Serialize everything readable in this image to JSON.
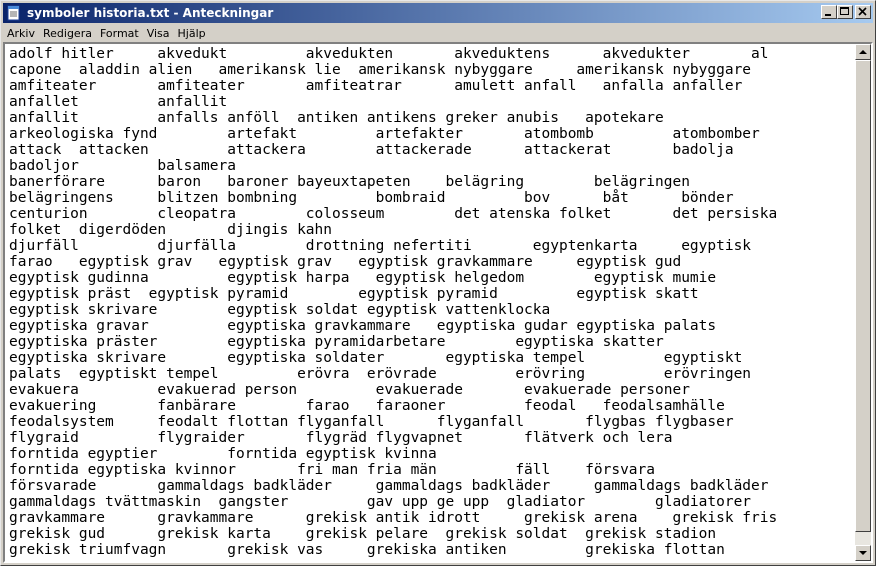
{
  "window": {
    "title": "symboler historia.txt - Anteckningar",
    "icons": {
      "app": "notepad-icon",
      "minimize": "minimize-icon",
      "maximize": "maximize-icon",
      "close": "close-icon"
    }
  },
  "menu": [
    "Arkiv",
    "Redigera",
    "Format",
    "Visa",
    "Hjälp"
  ],
  "lines": [
    "adolf hitler     akvedukt         akvedukten       akveduktens      akvedukter       al",
    "capone  aladdin alien   amerikansk lie  amerikansk nybyggare     amerikansk nybyggare",
    "amfiteater       amfiteater       amfiteatrar      amulett anfall   anfalla anfaller",
    "anfallet         anfallit",
    "anfallit         anfalls anföll  antiken antikens greker anubis   apotekare",
    "arkeologiska fynd        artefakt         artefakter       atombomb         atombomber",
    "attack  attacken         attackera        attackerade      attackerat       badolja",
    "badoljor         balsamera",
    "banerförare      baron   baroner bayeuxtapeten    belägring        belägringen",
    "belägringens     blitzen bombning         bombraid         bov      båt      bönder",
    "centurion        cleopatra        colosseum        det atenska folket       det persiska",
    "folket  digerdöden       djingis kahn",
    "djurfäll         djurfälla        drottning nefertiti       egyptenkarta     egyptisk",
    "farao   egyptisk grav   egyptisk grav   egyptisk gravkammare     egyptisk gud",
    "egyptisk gudinna         egyptisk harpa   egyptisk helgedom        egyptisk mumie",
    "egyptisk präst  egyptisk pyramid        egyptisk pyramid         egyptisk skatt",
    "egyptisk skrivare        egyptisk soldat egyptisk vattenklocka",
    "egyptiska gravar         egyptiska gravkammare   egyptiska gudar egyptiska palats",
    "egyptiska präster        egyptiska pyramidarbetare        egyptiska skatter",
    "egyptiska skrivare       egyptiska soldater       egyptiska tempel         egyptiskt",
    "palats  egyptiskt tempel         erövra  erövrade         erövring         erövringen",
    "evakuera         evakuerad person         evakuerade       evakuerade personer",
    "evakuering       fanbärare        farao   faraoner         feodal   feodalsamhälle",
    "feodalsystem     feodalt flottan flyganfall      flyganfall       flygbas flygbaser",
    "flygraid         flygraider       flygräd flygvapnet       flätverk och lera",
    "forntida egyptier        forntida egyptisk kvinna",
    "forntida egyptiska kvinnor       fri man fria män         fäll    försvara",
    "försvarade       gammaldags badkläder     gammaldags badkläder     gammaldags badkläder",
    "gammaldags tvättmaskin  gangster         gav upp ge upp  gladiator        gladiatorer",
    "gravkammare      gravkammare      grekisk antik idrott     grekisk arena    grekisk fris",
    "grekisk gud      grekisk karta    grekisk pelare  grekisk soldat  grekisk stadion",
    "grekisk triumfvagn       grekisk vas     grekiska antiken         grekiska flottan"
  ]
}
